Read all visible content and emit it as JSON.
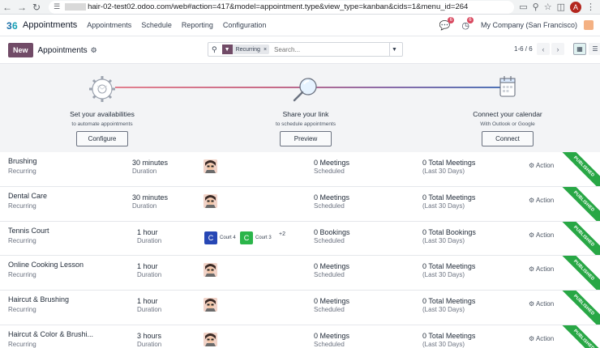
{
  "browser": {
    "url_prefix": "",
    "url_main": "hair-02-test02.odoo.com/web#action=417&model=appointment.type&view_type=kanban&cids=1&menu_id=264",
    "profile_initial": "A"
  },
  "navbar": {
    "app_name": "Appointments",
    "menus": [
      "Appointments",
      "Schedule",
      "Reporting",
      "Configuration"
    ],
    "messages_count": "6",
    "activities_count": "6",
    "company": "My Company (San Francisco)"
  },
  "control_panel": {
    "new_label": "New",
    "title": "Appointments",
    "facet_label": "Recurring",
    "search_placeholder": "Search...",
    "pager": "1-6 / 6"
  },
  "onboarding": {
    "steps": [
      {
        "title": "Set your availabilities",
        "subtitle": "to automate appointments",
        "button": "Configure",
        "icon": "gear-icon"
      },
      {
        "title": "Share your link",
        "subtitle": "to schedule appointments",
        "button": "Preview",
        "icon": "magnifier-icon"
      },
      {
        "title": "Connect your calendar",
        "subtitle": "With Outlook or Google",
        "button": "Connect",
        "icon": "calendar-icon"
      }
    ]
  },
  "rows": [
    {
      "name": "Brushing",
      "type": "Recurring",
      "duration": "30 minutes",
      "duration_label": "Duration",
      "meetings": "0 Meetings",
      "meetings_label": "Scheduled",
      "total": "0 Total Meetings",
      "total_label": "(Last 30 Days)",
      "action": "Action",
      "ribbon": "PUBLISHED",
      "resources": "avatar"
    },
    {
      "name": "Dental Care",
      "type": "Recurring",
      "duration": "30 minutes",
      "duration_label": "Duration",
      "meetings": "0 Meetings",
      "meetings_label": "Scheduled",
      "total": "0 Total Meetings",
      "total_label": "(Last 30 Days)",
      "action": "Action",
      "ribbon": "PUBLISHED",
      "resources": "avatar"
    },
    {
      "name": "Tennis Court",
      "type": "Recurring",
      "duration": "1 hour",
      "duration_label": "Duration",
      "meetings": "0 Bookings",
      "meetings_label": "Scheduled",
      "total": "0 Total Bookings",
      "total_label": "(Last 30 Days)",
      "action": "Action",
      "ribbon": "PUBLISHED",
      "resources": "courts",
      "court_a": "Court 4",
      "court_b": "Court 3",
      "more": "+2",
      "court_a_color": "#2747b5",
      "court_b_color": "#2bb54a"
    },
    {
      "name": "Online Cooking Lesson",
      "type": "Recurring",
      "duration": "1 hour",
      "duration_label": "Duration",
      "meetings": "0 Meetings",
      "meetings_label": "Scheduled",
      "total": "0 Total Meetings",
      "total_label": "(Last 30 Days)",
      "action": "Action",
      "ribbon": "PUBLISHED",
      "resources": "avatar"
    },
    {
      "name": "Haircut & Brushing",
      "type": "Recurring",
      "duration": "1 hour",
      "duration_label": "Duration",
      "meetings": "0 Meetings",
      "meetings_label": "Scheduled",
      "total": "0 Total Meetings",
      "total_label": "(Last 30 Days)",
      "action": "Action",
      "ribbon": "PUBLISHED",
      "resources": "avatar"
    },
    {
      "name": "Haircut & Color & Brushi...",
      "type": "Recurring",
      "duration": "3 hours",
      "duration_label": "Duration",
      "meetings": "0 Meetings",
      "meetings_label": "Scheduled",
      "total": "0 Total Meetings",
      "total_label": "(Last 30 Days)",
      "action": "Action",
      "ribbon": "PUBLISHED",
      "resources": "avatar"
    }
  ]
}
